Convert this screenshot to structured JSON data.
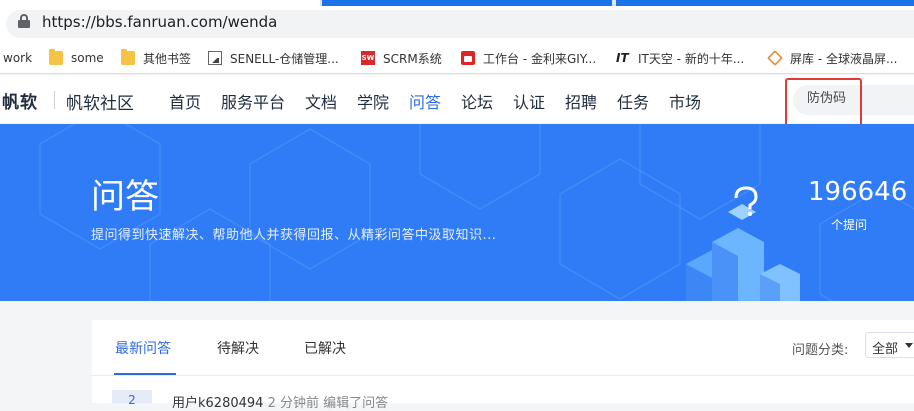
{
  "browser": {
    "url": "https://bbs.fanruan.com/wenda",
    "bookmarks": [
      "work",
      "some",
      "其他书签",
      "SENELL-仓储管理...",
      "SCRM系统",
      "工作台 - 金利来GIY...",
      "IT天空 - 新的十年...",
      "屏库 - 全球液晶屏..."
    ],
    "bookmark_icons": [
      "none",
      "folder-icon",
      "folder-icon",
      "image-icon",
      "sw-icon",
      "thumbs-up-icon",
      "it-icon",
      "diamond-icon"
    ],
    "sw_icon_text": "SW",
    "it_icon_text": "IT"
  },
  "header": {
    "logo": "帆软",
    "community": "帆软社区",
    "nav": [
      "首页",
      "服务平台",
      "文档",
      "学院",
      "问答",
      "论坛",
      "认证",
      "招聘",
      "任务",
      "市场"
    ],
    "active_nav": "问答",
    "search_placeholder": "防伪码"
  },
  "banner": {
    "title": "问答",
    "subtitle": "提问得到快速解决、帮助他人并获得回报、从精彩问答中汲取知识...",
    "question_count": "196646",
    "question_count_label": "个提问",
    "colors": {
      "background": "#2f7cf6",
      "accent": "#2d6be4"
    }
  },
  "content": {
    "tabs": [
      "最新问答",
      "待解决",
      "已解决"
    ],
    "active_tab": "最新问答",
    "filter_label": "问题分类:",
    "filter_value": "全部",
    "first_row": {
      "count": "2",
      "user": "用户k6280494",
      "meta": "2 分钟前 编辑了问答"
    }
  },
  "annotation": {
    "highlight_color": "#e53935"
  }
}
